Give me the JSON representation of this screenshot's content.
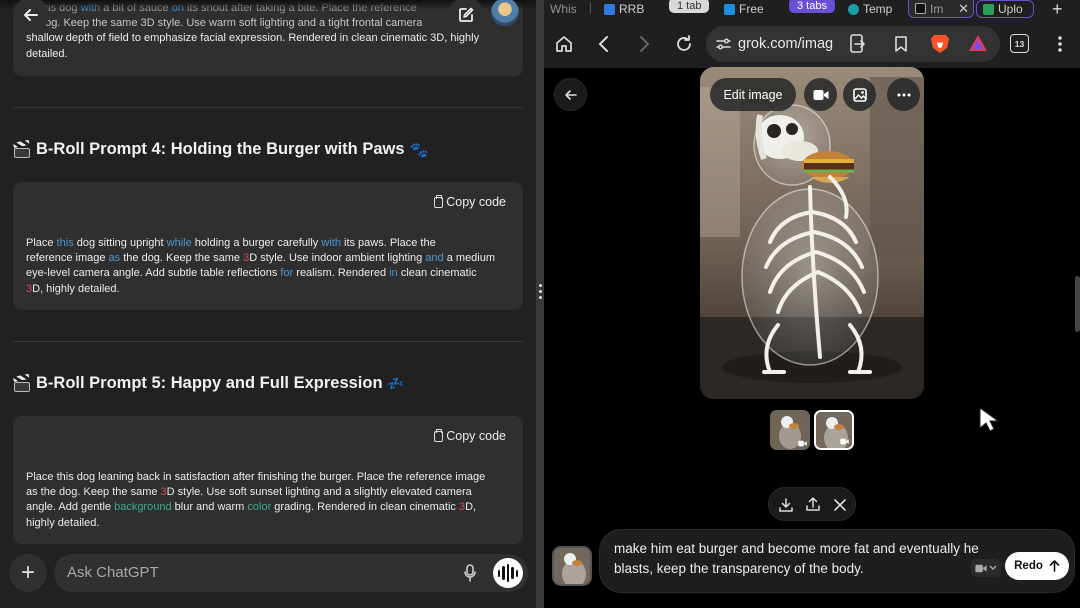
{
  "chatgpt": {
    "prompt3_tail": [
      {
        "t": "this dog ",
        "c": ""
      },
      {
        "t": "with",
        "c": "b"
      },
      {
        "t": " a bit of sauce ",
        "c": ""
      },
      {
        "t": "on",
        "c": "b"
      },
      {
        "t": " its snout after taking a bite. Place the reference",
        "c": ""
      }
    ],
    "prompt3_line2": "dog. Keep the same 3D style. Use warm soft lighting and a tight frontal camera",
    "prompt3_line3": "shallow depth of field to emphasize facial expression. Rendered in clean cinematic 3D, highly",
    "prompt3_line4": "detailed.",
    "heading4": "B-Roll Prompt 4: Holding the Burger with Paws",
    "heading5": "B-Roll Prompt 5: Happy and Full Expression",
    "copy_label": "Copy code",
    "prompt4": [
      [
        {
          "t": "Place ",
          "c": ""
        },
        {
          "t": "this",
          "c": "b"
        },
        {
          "t": " dog sitting upright ",
          "c": ""
        },
        {
          "t": "while",
          "c": "b"
        },
        {
          "t": " holding a burger carefully ",
          "c": ""
        },
        {
          "t": "with",
          "c": "b"
        },
        {
          "t": " its paws. Place the",
          "c": ""
        }
      ],
      [
        {
          "t": "reference image ",
          "c": ""
        },
        {
          "t": "as",
          "c": "b"
        },
        {
          "t": " the dog. Keep the same ",
          "c": ""
        },
        {
          "t": "3",
          "c": "r"
        },
        {
          "t": "D style. Use indoor ambient lighting ",
          "c": ""
        },
        {
          "t": "and",
          "c": "b"
        },
        {
          "t": " a medium",
          "c": ""
        }
      ],
      [
        {
          "t": "eye-level camera angle. Add subtle table reflections ",
          "c": ""
        },
        {
          "t": "for",
          "c": "b"
        },
        {
          "t": " realism. Rendered ",
          "c": ""
        },
        {
          "t": "in",
          "c": "b"
        },
        {
          "t": " clean cinematic",
          "c": ""
        }
      ],
      [
        {
          "t": "3",
          "c": "r"
        },
        {
          "t": "D, highly detailed.",
          "c": ""
        }
      ]
    ],
    "prompt5": [
      [
        {
          "t": "Place this dog leaning back in satisfaction after finishing the burger. Place the reference image",
          "c": ""
        }
      ],
      [
        {
          "t": "as the dog. Keep the same ",
          "c": ""
        },
        {
          "t": "3",
          "c": "r"
        },
        {
          "t": "D style. Use soft sunset lighting and a slightly elevated camera",
          "c": ""
        }
      ],
      [
        {
          "t": "angle. Add gentle ",
          "c": ""
        },
        {
          "t": "background",
          "c": "g"
        },
        {
          "t": " blur and warm ",
          "c": ""
        },
        {
          "t": "color",
          "c": "g"
        },
        {
          "t": " grading. Rendered in clean cinematic ",
          "c": ""
        },
        {
          "t": "3",
          "c": "r"
        },
        {
          "t": "D,",
          "c": ""
        }
      ],
      [
        {
          "t": "highly detailed.",
          "c": ""
        }
      ]
    ],
    "ask_placeholder": "Ask ChatGPT"
  },
  "browser": {
    "tabs": [
      {
        "label": "Whis",
        "color": "#888"
      },
      {
        "label": "RRB",
        "color": "#2f7be0"
      },
      {
        "label": "1 tab",
        "color": "#555",
        "pill": true
      },
      {
        "label": "Free",
        "color": "#1f8fe0"
      },
      {
        "label": "3 tabs",
        "color": "#6b4fd8",
        "pill": true
      },
      {
        "label": "Temp",
        "color": "#19a0a8"
      },
      {
        "label": "Im",
        "color": "#888"
      },
      {
        "label": "Uplo",
        "color": "#2aa05a"
      }
    ],
    "url": "grok.com/imag",
    "tab_count": "13"
  },
  "grok": {
    "edit_label": "Edit image",
    "prompt": "make him eat burger and become more fat and eventually he blasts, keep the transparency of the body.",
    "redo_label": "Redo"
  },
  "colors": {
    "chat_bg": "#212121",
    "card_bg": "#2f2f2f",
    "keyword_blue": "#4e94ce",
    "keyword_green": "#3fa88e",
    "keyword_red": "#d9495b",
    "browser_brave": "#fb542b"
  },
  "icons": [
    "back-arrow-icon",
    "edit-icon",
    "copy-icon",
    "clapperboard-icon",
    "paw-icon",
    "sleep-icon",
    "plus-icon",
    "microphone-icon",
    "voice-waveform-icon",
    "home-icon",
    "chevron-left-icon",
    "chevron-right-icon",
    "reload-icon",
    "site-settings-icon",
    "share-icon",
    "bookmark-icon",
    "brave-icon",
    "aurora-icon",
    "tab-switcher-icon",
    "more-vertical-icon",
    "video-icon",
    "image-icon",
    "download-icon",
    "upload-icon",
    "x-logo-icon",
    "arrow-up-icon",
    "cursor-icon"
  ]
}
